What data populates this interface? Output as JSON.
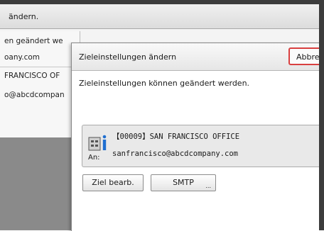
{
  "background": {
    "header_text": "ändern.",
    "lines": [
      "en geändert we",
      "oany.com",
      "FRANCISCO OF",
      "o@abcdcompan"
    ]
  },
  "dialog": {
    "title": "Zieleinstellungen ändern",
    "cancel_label": "Abbre",
    "message": "Zieleinstellungen können geändert werden.",
    "destination": {
      "name": "【00009】SAN FRANCISCO OFFICE",
      "to_label": "An:",
      "email": "sanfrancisco@abcdcompany.com",
      "icon": "destination-info-icon"
    },
    "edit_button": "Ziel bearb.",
    "smtp_button": "SMTP",
    "smtp_more": "..."
  },
  "colors": {
    "bezel": "#3c3c3c",
    "cancel_border": "#d94040",
    "info_blue": "#1f6fd1"
  }
}
